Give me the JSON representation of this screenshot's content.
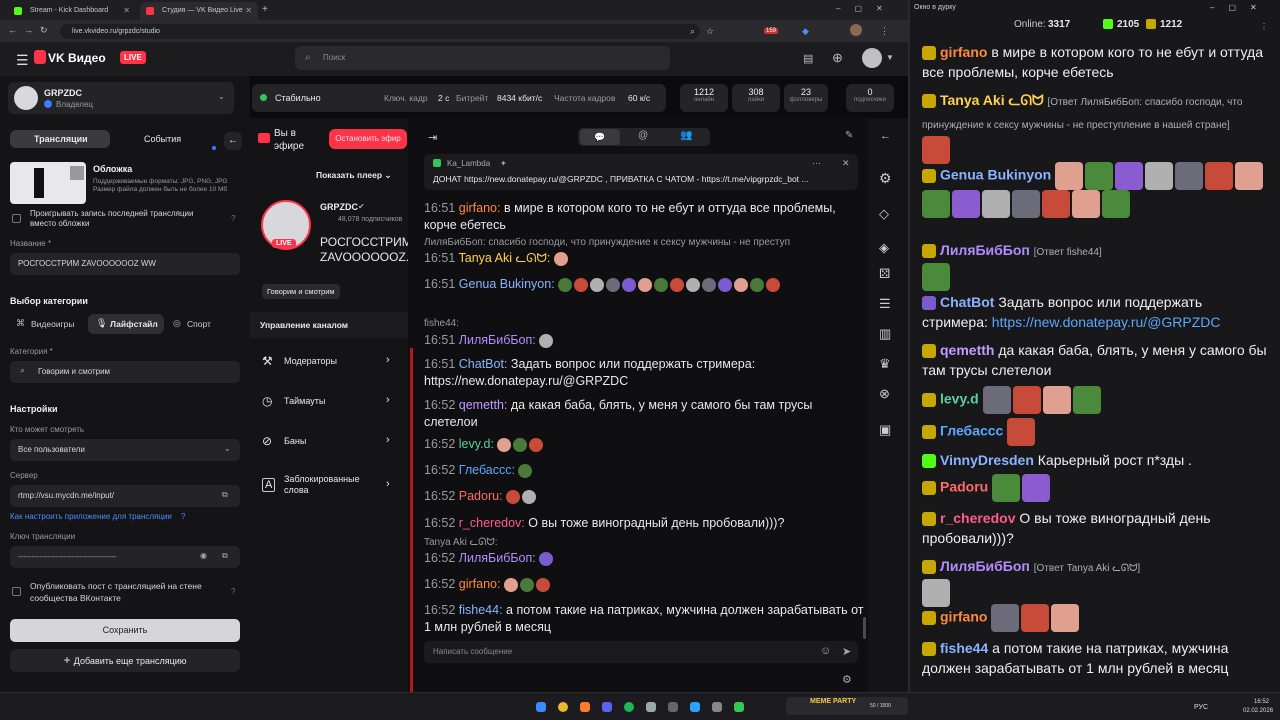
{
  "browser": {
    "tabs": [
      {
        "label": "Stream - Kick Dashboard"
      },
      {
        "label": "Студия — VK Видео Live"
      }
    ],
    "url": "live.vkvideo.ru/grpzdc/studio",
    "ext_badge": "159"
  },
  "site": {
    "logo": "VK Видео",
    "live_badge": "LIVE",
    "search_placeholder": "Поиск"
  },
  "channel": {
    "name": "GRPZDC",
    "role": "Владелец"
  },
  "left": {
    "tab_streams": "Трансляции",
    "tab_events": "События",
    "cover_title": "Обложка",
    "cover_desc": "Поддерживаемые форматы: JPG, PNG, JPG Размер файла должен быть не более 10 Мб",
    "replay_label": "Проигрывать запись последней трансляции вместо обложки",
    "name_label": "Название *",
    "name_value": "РОСГОССТРИМ ZAVOOOOOOZ WW",
    "category_choice": "Выбор категории",
    "cat_games": "Видеоигры",
    "cat_life": "Лайфстайл",
    "cat_sport": "Спорт",
    "category_label": "Категория *",
    "category_value": "Говорим и смотрим",
    "settings": "Настройки",
    "who_label": "Кто может смотреть",
    "who_value": "Все пользователи",
    "server_label": "Сервер",
    "server_value": "rtmp://vsu.mycdn.me/input/",
    "howto": "Как настроить приложение для трансляции",
    "key_label": "Ключ трансляции",
    "key_value": "-------------------------------------",
    "publish_label": "Опубликовать пост с трансляцией на стене сообщества ВКонтакте",
    "save": "Сохранить",
    "add_more": "Добавить еще трансляцию"
  },
  "status": {
    "state": "Стабильно",
    "key_frame_label": "Ключ. кадр",
    "key_frame": "2 с",
    "bitrate_label": "Битрейт",
    "bitrate": "8434 кбит/с",
    "fps_label": "Частота кадров",
    "fps": "60 к/с",
    "stats": [
      {
        "n": "1212",
        "t": "онлайн"
      },
      {
        "n": "308",
        "t": "лайки"
      },
      {
        "n": "23",
        "t": "фолловеры"
      },
      {
        "n": "0",
        "t": "подписчики"
      }
    ]
  },
  "stream": {
    "on_air": "Вы в эфире",
    "stop": "Остановить эфир",
    "show_player": "Показать плеер",
    "channel": "GRPZDC",
    "subs": "48,078 подписчиков",
    "title": "РОСГОССТРИМ ZAVOOOOOOZ...",
    "live": "LIVE",
    "tag": "Говорим и смотрим",
    "manage": "Управление каналом",
    "nav": [
      "Модераторы",
      "Таймауты",
      "Баны",
      "Заблокированные слова"
    ]
  },
  "chat": {
    "pinned_user": "Ka_Lambda",
    "pinned_text": "ДОНАТ https://new.donatepay.ru/@GRPZDC , ПРИВАТКА С ЧАТОМ - https://t.me/vipgrpzdc_bot ...",
    "input_placeholder": "Написать сообщение",
    "messages": [
      {
        "time": "16:51",
        "user": "girfano:",
        "text": "в мире в котором кого то не ебут и оттуда все проблемы, корче ебетесь",
        "color": "#ff8a3d"
      },
      {
        "reply": "ЛиляБибБоп: спасибо господи, что принуждение к сексу мужчины - не преступ"
      },
      {
        "time": "16:51",
        "user": "Tanya Aki ᓚᘏᗢ:",
        "text": "",
        "color": "#ffd24a"
      },
      {
        "time": "16:51",
        "user": "Genua Bukinyon:",
        "text": "",
        "color": "#8ab4ff"
      },
      {
        "reply": "fishe44:"
      },
      {
        "time": "16:51",
        "user": "ЛиляБибБоп:",
        "text": "",
        "color": "#b28cff"
      },
      {
        "time": "16:51",
        "user": "ChatBot:",
        "text": "Задать вопрос или поддержать стримера: https://new.donatepay.ru/@GRPZDC",
        "color": "#8ab4ff"
      },
      {
        "time": "16:52",
        "user": "qemetth:",
        "text": "да какая баба, блять, у меня у самого бы там трусы слетелои",
        "color": "#c59bff"
      },
      {
        "time": "16:52",
        "user": "levy.d:",
        "text": "",
        "color": "#5ccfa0"
      },
      {
        "time": "16:52",
        "user": "Глебасcс:",
        "text": "",
        "color": "#5aa8ff"
      },
      {
        "time": "16:52",
        "user": "Padoru:",
        "text": "",
        "color": "#ff6a6a"
      },
      {
        "time": "16:52",
        "user": "r_cheredov:",
        "text": "О вы тоже виноградный день пробовали)))?",
        "color": "#ff5c8a"
      },
      {
        "reply": "Tanya Aki ᓚᘏᗢ:"
      },
      {
        "time": "16:52",
        "user": "ЛиляБибБоп:",
        "text": "",
        "color": "#b28cff"
      },
      {
        "time": "16:52",
        "user": "girfano:",
        "text": "",
        "color": "#ff8a3d"
      },
      {
        "time": "16:52",
        "user": "fishe44:",
        "text": "а потом такие на патриках, мужчина должен зарабатывать от 1 млн рублей в месяц",
        "color": "#8ab4ff"
      }
    ]
  },
  "popout": {
    "title": "Окно в дурку",
    "online_label": "Online:",
    "online": "3317",
    "kick": "2105",
    "vk": "1212",
    "messages": [
      {
        "user": "girfano",
        "text": "в мире в котором кого то не ебут и оттуда все проблемы, корче ебетесь",
        "color": "#ff8a3d"
      },
      {
        "user": "Tanya Aki ᓚᘏᗢ",
        "reply": "[Ответ ЛиляБибБоп: спасибо господи, что принуждение к сексу мужчины - не преступление в нашей стране]",
        "color": "#ffd24a"
      },
      {
        "user": "Genua Bukinyon",
        "color": "#8ab4ff"
      },
      {
        "user": "ЛиляБибБоп",
        "reply": "[Ответ fishe44]",
        "color": "#b28cff"
      },
      {
        "user": "ChatBot",
        "text": "Задать вопрос или поддержать стримера:",
        "link": "https://new.donatepay.ru/@GRPZDC",
        "color": "#8ab4ff"
      },
      {
        "user": "qemetth",
        "text": "да какая баба, блять, у меня у самого бы там трусы слетелои",
        "color": "#c59bff"
      },
      {
        "user": "levy.d",
        "color": "#5ccfa0"
      },
      {
        "user": "Глебасcс",
        "color": "#5aa8ff"
      },
      {
        "user": "VinnyDresden",
        "text": "Карьерный рост п*зды .",
        "color": "#8ab4ff"
      },
      {
        "user": "Padoru",
        "color": "#ff6a6a"
      },
      {
        "user": "r_cheredov",
        "text": "О вы тоже виноградный день пробовали)))?",
        "color": "#ff5c8a"
      },
      {
        "user": "ЛиляБибБоп",
        "reply": "[Ответ Tanya Aki ᓚᘏᗢ]",
        "color": "#b28cff"
      },
      {
        "user": "girfano",
        "color": "#ff8a3d"
      },
      {
        "user": "fishe44",
        "text": "а потом такие на патриках, мужчина должен зарабатывать от 1 млн рублей в месяц",
        "color": "#8ab4ff"
      }
    ]
  },
  "taskbar": {
    "time": "16:52",
    "date": "02.02.2026",
    "lang": "РУС",
    "party": "MEME PARTY",
    "party_count": "50 / 1500"
  }
}
